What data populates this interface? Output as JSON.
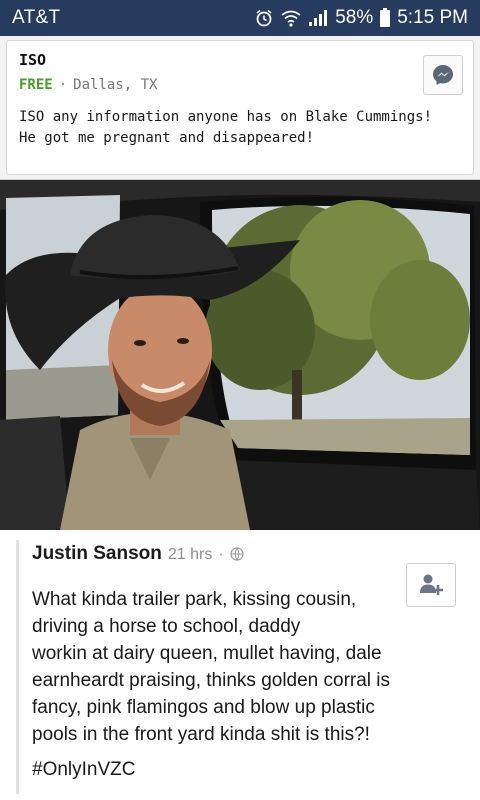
{
  "status_bar": {
    "carrier": "AT&T",
    "battery_percent": "58%",
    "time": "5:15 PM",
    "icons": [
      "alarm-icon",
      "wifi-icon",
      "signal-icon",
      "battery-icon"
    ]
  },
  "listing": {
    "title": "ISO",
    "price": "FREE",
    "separator": "·",
    "location": "Dallas, TX",
    "description_line1": "ISO any information anyone has on Blake Cummings!",
    "description_line2": "He got me pregnant and disappeared!",
    "action_icon": "messenger-icon"
  },
  "photo": {
    "icon": "photo"
  },
  "comment": {
    "author": "Justin Sanson",
    "time": "21 hrs",
    "separator": "·",
    "privacy_icon": "globe-icon",
    "body_lines": [
      "What kinda trailer park, kissing cousin,",
      "driving a horse to school, daddy",
      "workin at dairy queen, mullet having, dale",
      "earnheardt praising, thinks golden corral is",
      "fancy, pink flamingos and blow up plastic",
      "pools in the front yard kinda shit is this?!"
    ],
    "hashtag": "#OnlyInVZC",
    "action_icon": "add-friend-icon"
  },
  "colors": {
    "status_bar": "#273b5e",
    "price": "#4c9a2a",
    "text": "#1a1a1a",
    "muted": "#8f8f8f"
  }
}
